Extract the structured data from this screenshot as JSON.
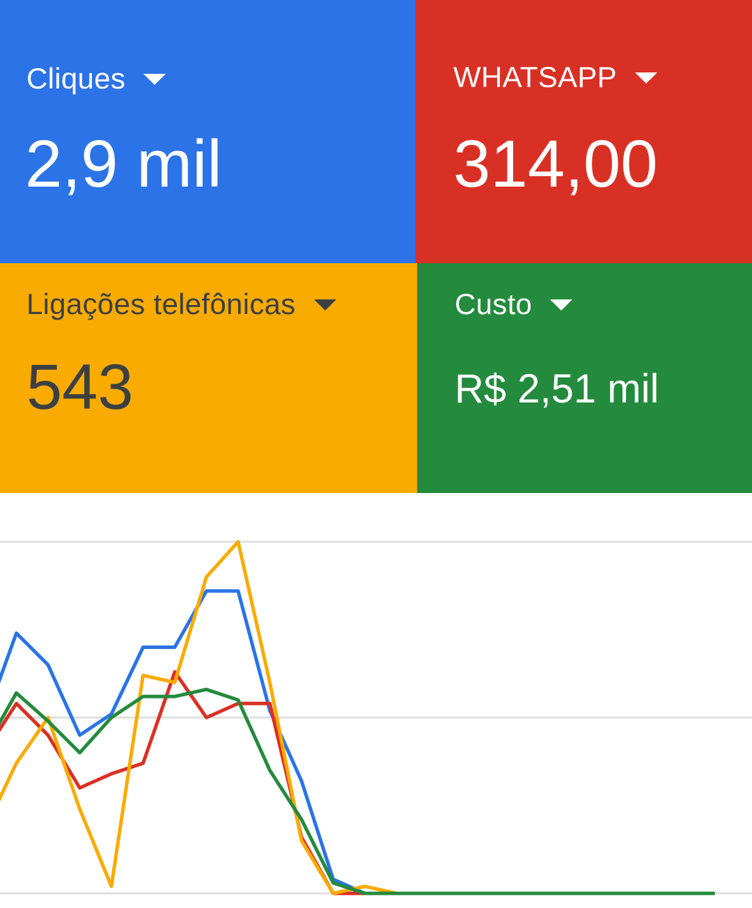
{
  "metrics": {
    "clicks": {
      "label": "Cliques",
      "value": "2,9 mil",
      "color": "#2b73e6",
      "text_color": "#ffffff",
      "icon": "caret-down-icon"
    },
    "whatsapp": {
      "label": "WHATSAPP",
      "value": "314,00",
      "color": "#d93025",
      "text_color": "#ffffff",
      "icon": "caret-down-icon"
    },
    "calls": {
      "label": "Ligações telefônicas",
      "value": "543",
      "color": "#f9ab00",
      "text_color": "#3c4043",
      "icon": "caret-down-icon"
    },
    "cost": {
      "label": "Custo",
      "value": "R$ 2,51 mil",
      "color": "#248a3d",
      "text_color": "#ffffff",
      "icon": "caret-down-icon"
    }
  },
  "chart_data": {
    "type": "line",
    "x": [
      0,
      1,
      2,
      3,
      4,
      5,
      6,
      7,
      8,
      9,
      10,
      11,
      12,
      13,
      14,
      15,
      16,
      17,
      18,
      19,
      20,
      21,
      22,
      23
    ],
    "ylim": [
      0,
      100
    ],
    "grid": true,
    "series": [
      {
        "color": "#2b73e6",
        "values": [
          49,
          74,
          65,
          45,
          51,
          70,
          70,
          86,
          86,
          52,
          32,
          4,
          0,
          0,
          0,
          0,
          0,
          0,
          0,
          0,
          0,
          0,
          0,
          0
        ]
      },
      {
        "color": "#d93025",
        "values": [
          40,
          54,
          45,
          30,
          34,
          37,
          63,
          50,
          54,
          54,
          16,
          0,
          0,
          0,
          0,
          0,
          0,
          0,
          0,
          0,
          0,
          0,
          0,
          0
        ]
      },
      {
        "color": "#f9ab00",
        "values": [
          18,
          37,
          50,
          24,
          2,
          62,
          60,
          90,
          100,
          60,
          15,
          0,
          2,
          0,
          0,
          0,
          0,
          0,
          0,
          0,
          0,
          0,
          0,
          0
        ]
      },
      {
        "color": "#248a3d",
        "values": [
          41,
          57,
          49,
          40,
          50,
          56,
          56,
          58,
          55,
          35,
          21,
          3,
          0,
          0,
          0,
          0,
          0,
          0,
          0,
          0,
          0,
          0,
          0,
          0
        ]
      }
    ]
  }
}
